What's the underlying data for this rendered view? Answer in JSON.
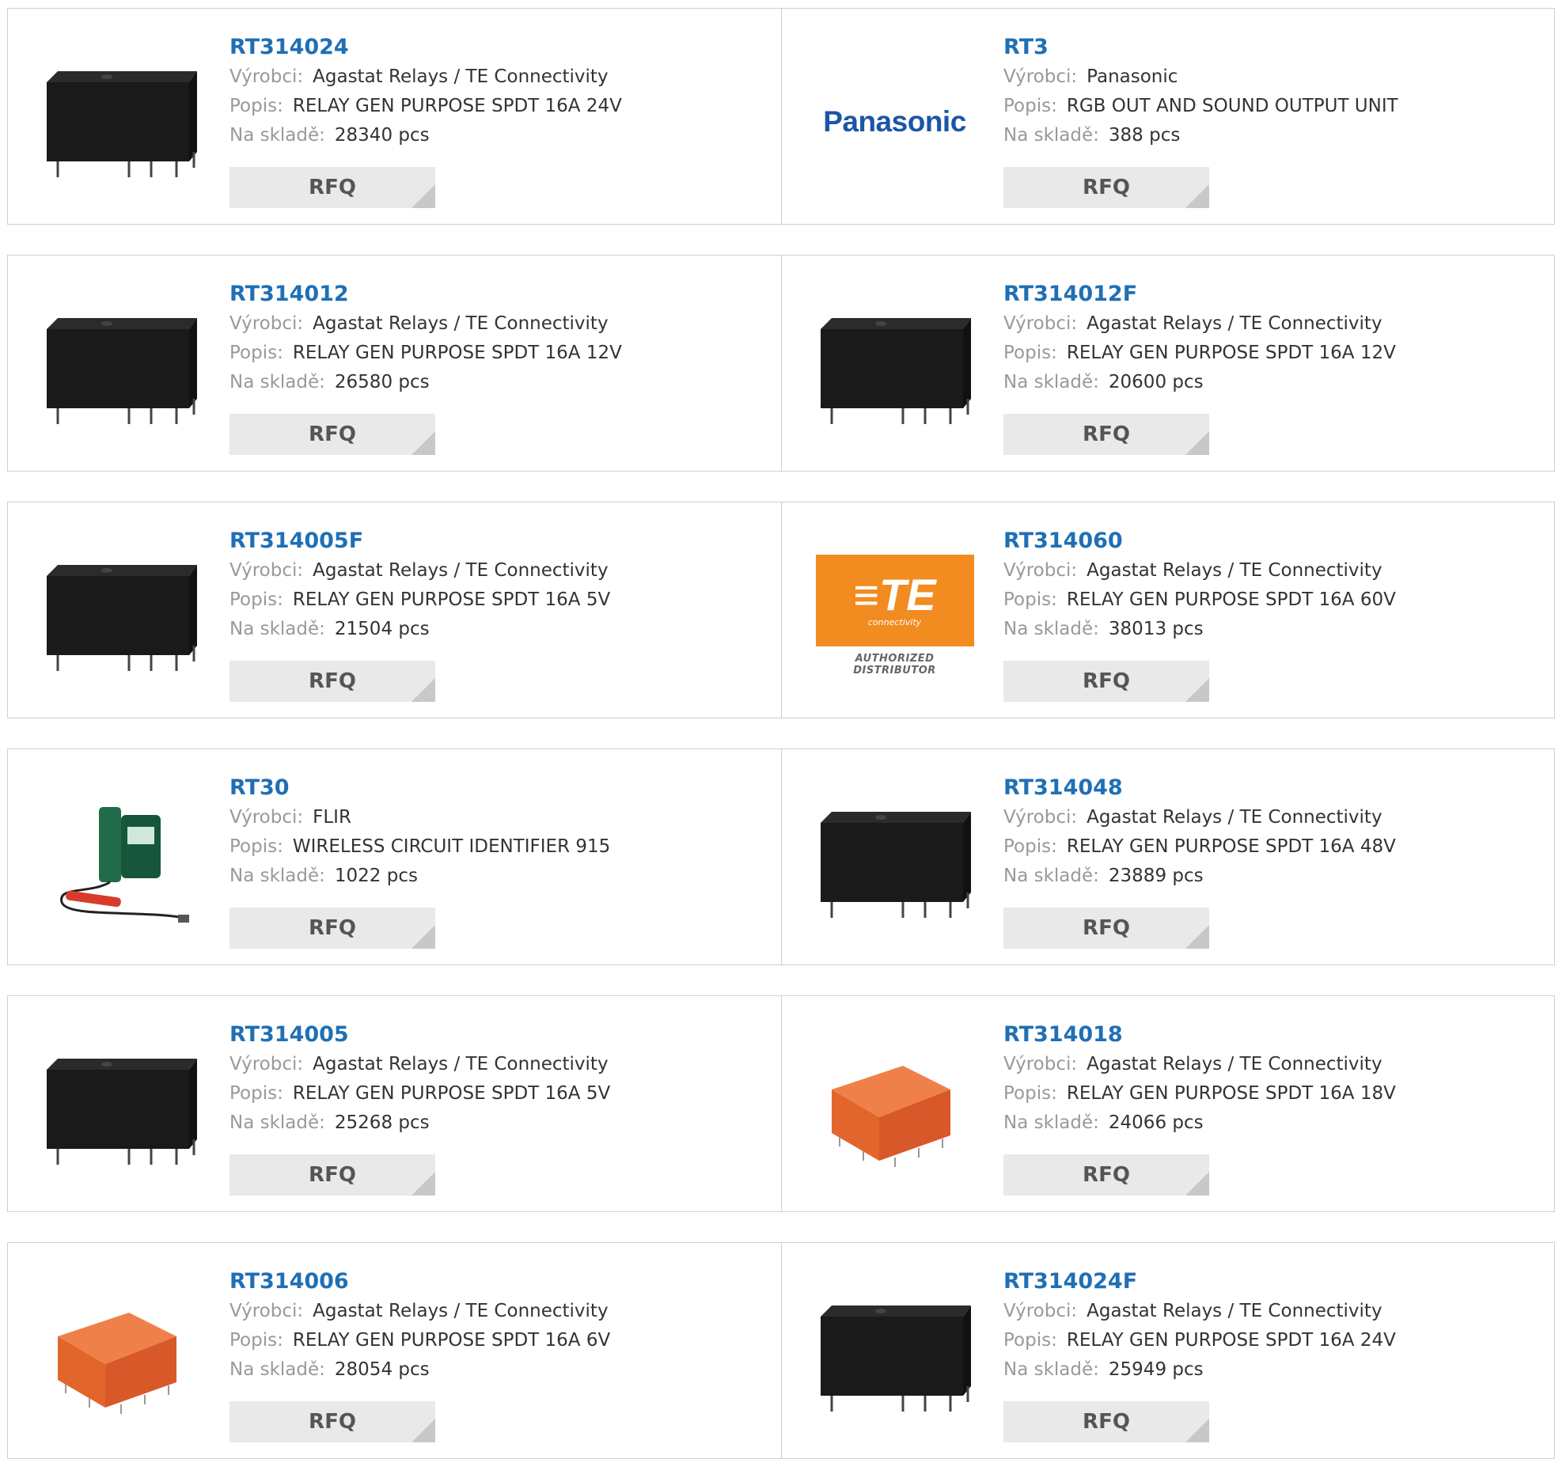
{
  "labels": {
    "manufacturer": "Výrobci:",
    "description": "Popis:",
    "stock": "Na skladě:",
    "rfq": "RFQ"
  },
  "products": [
    {
      "part": "RT314024",
      "manufacturer": "Agastat Relays / TE Connectivity",
      "description": "RELAY GEN PURPOSE SPDT 16A 24V",
      "stock": "28340 pcs",
      "image": "black-relay"
    },
    {
      "part": "RT3",
      "manufacturer": "Panasonic",
      "description": "RGB OUT AND SOUND OUTPUT UNIT",
      "stock": "388 pcs",
      "image": "panasonic-logo",
      "logo_text": "Panasonic"
    },
    {
      "part": "RT314012",
      "manufacturer": "Agastat Relays / TE Connectivity",
      "description": "RELAY GEN PURPOSE SPDT 16A 12V",
      "stock": "26580 pcs",
      "image": "black-relay"
    },
    {
      "part": "RT314012F",
      "manufacturer": "Agastat Relays / TE Connectivity",
      "description": "RELAY GEN PURPOSE SPDT 16A 12V",
      "stock": "20600 pcs",
      "image": "black-relay"
    },
    {
      "part": "RT314005F",
      "manufacturer": "Agastat Relays / TE Connectivity",
      "description": "RELAY GEN PURPOSE SPDT 16A 5V",
      "stock": "21504 pcs",
      "image": "black-relay"
    },
    {
      "part": "RT314060",
      "manufacturer": "Agastat Relays / TE Connectivity",
      "description": "RELAY GEN PURPOSE SPDT 16A 60V",
      "stock": "38013 pcs",
      "image": "te-logo",
      "logo_text": "TE",
      "logo_sub": "connectivity",
      "logo_caption": "AUTHORIZED DISTRIBUTOR"
    },
    {
      "part": "RT30",
      "manufacturer": "FLIR",
      "description": "WIRELESS CIRCUIT IDENTIFIER 915",
      "stock": "1022 pcs",
      "image": "circuit-identifier"
    },
    {
      "part": "RT314048",
      "manufacturer": "Agastat Relays / TE Connectivity",
      "description": "RELAY GEN PURPOSE SPDT 16A 48V",
      "stock": "23889 pcs",
      "image": "black-relay"
    },
    {
      "part": "RT314005",
      "manufacturer": "Agastat Relays / TE Connectivity",
      "description": "RELAY GEN PURPOSE SPDT 16A 5V",
      "stock": "25268 pcs",
      "image": "black-relay"
    },
    {
      "part": "RT314018",
      "manufacturer": "Agastat Relays / TE Connectivity",
      "description": "RELAY GEN PURPOSE SPDT 16A 18V",
      "stock": "24066 pcs",
      "image": "orange-relay"
    },
    {
      "part": "RT314006",
      "manufacturer": "Agastat Relays / TE Connectivity",
      "description": "RELAY GEN PURPOSE SPDT 16A 6V",
      "stock": "28054 pcs",
      "image": "orange-relay"
    },
    {
      "part": "RT314024F",
      "manufacturer": "Agastat Relays / TE Connectivity",
      "description": "RELAY GEN PURPOSE SPDT 16A 24V",
      "stock": "25949 pcs",
      "image": "black-relay"
    }
  ],
  "colors": {
    "link": "#1f6fb5",
    "label": "#999999",
    "value": "#333333",
    "rfq_bg": "#e9e9e9",
    "te_orange": "#f28b20",
    "panasonic_blue": "#1b56a6"
  }
}
